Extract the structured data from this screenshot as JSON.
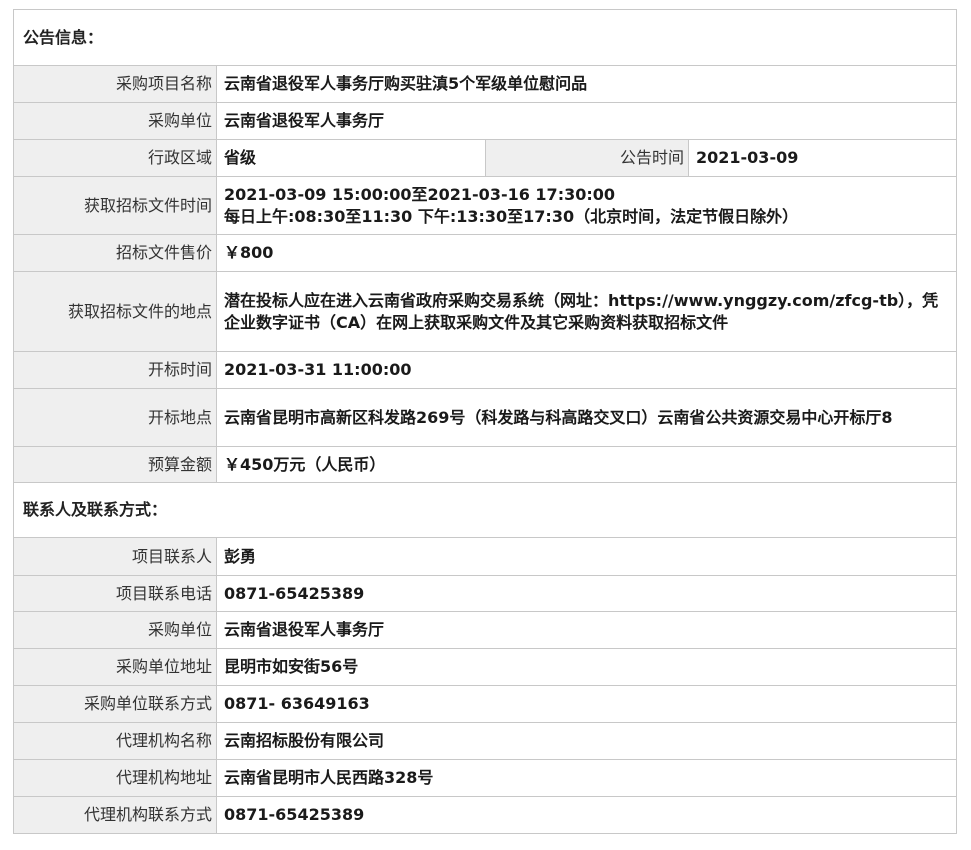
{
  "section_announcement": {
    "title": "公告信息："
  },
  "announcement": {
    "project_name_label": "采购项目名称",
    "project_name": "云南省退役军人事务厅购买驻滇5个军级单位慰问品",
    "purchaser_label": "采购单位",
    "purchaser": "云南省退役军人事务厅",
    "region_label": "行政区域",
    "region": "省级",
    "publish_time_label": "公告时间",
    "publish_time": "2021-03-09",
    "doc_time_label": "获取招标文件时间",
    "doc_time_line1": "2021-03-09 15:00:00至2021-03-16 17:30:00",
    "doc_time_line2": "每日上午:08:30至11:30  下午:13:30至17:30（北京时间，法定节假日除外）",
    "doc_price_label": "招标文件售价",
    "doc_price": "￥800",
    "doc_location_label": "获取招标文件的地点",
    "doc_location": "潜在投标人应在进入云南省政府采购交易系统（网址：https://www.ynggzy.com/zfcg-tb），凭企业数字证书（CA）在网上获取采购文件及其它采购资料获取招标文件",
    "bid_open_time_label": "开标时间",
    "bid_open_time": "2021-03-31 11:00:00",
    "bid_open_location_label": "开标地点",
    "bid_open_location": "云南省昆明市高新区科发路269号（科发路与科高路交叉口）云南省公共资源交易中心开标厅8",
    "budget_label": "预算金额",
    "budget": "￥450万元（人民币）"
  },
  "section_contact": {
    "title": "联系人及联系方式："
  },
  "contact": {
    "project_contact_label": "项目联系人",
    "project_contact": "彭勇",
    "project_phone_label": "项目联系电话",
    "project_phone": "0871-65425389",
    "purchaser_label": "采购单位",
    "purchaser": "云南省退役军人事务厅",
    "purchaser_address_label": "采购单位地址",
    "purchaser_address": "昆明市如安街56号",
    "purchaser_phone_label": "采购单位联系方式",
    "purchaser_phone": "0871- 63649163",
    "agency_name_label": "代理机构名称",
    "agency_name": "云南招标股份有限公司",
    "agency_address_label": "代理机构地址",
    "agency_address": "云南省昆明市人民西路328号",
    "agency_phone_label": "代理机构联系方式",
    "agency_phone": "0871-65425389"
  }
}
